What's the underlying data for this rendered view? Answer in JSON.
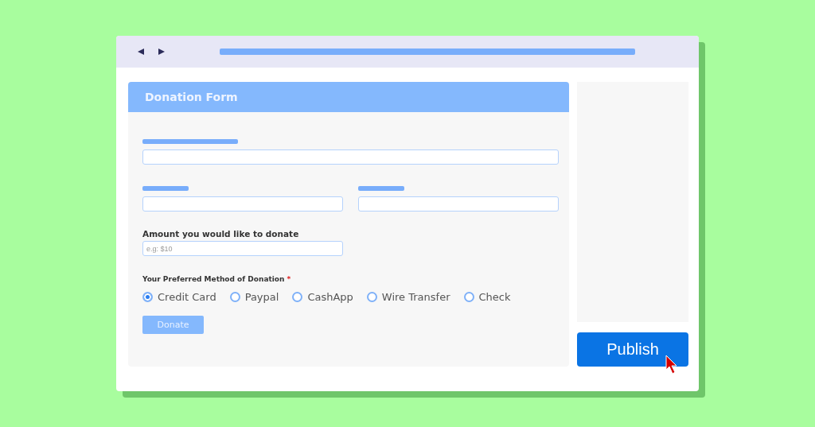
{
  "form": {
    "title": "Donation Form",
    "amount": {
      "label": "Amount you would like to donate",
      "placeholder": "e.g: $10"
    },
    "method": {
      "label": "Your Preferred Method of Donation",
      "required_mark": "*",
      "options": [
        {
          "label": "Credit Card",
          "selected": true
        },
        {
          "label": "Paypal",
          "selected": false
        },
        {
          "label": "CashApp",
          "selected": false
        },
        {
          "label": "Wire Transfer",
          "selected": false
        },
        {
          "label": "Check",
          "selected": false
        }
      ]
    },
    "submit": "Donate"
  },
  "publish_button": "Publish"
}
